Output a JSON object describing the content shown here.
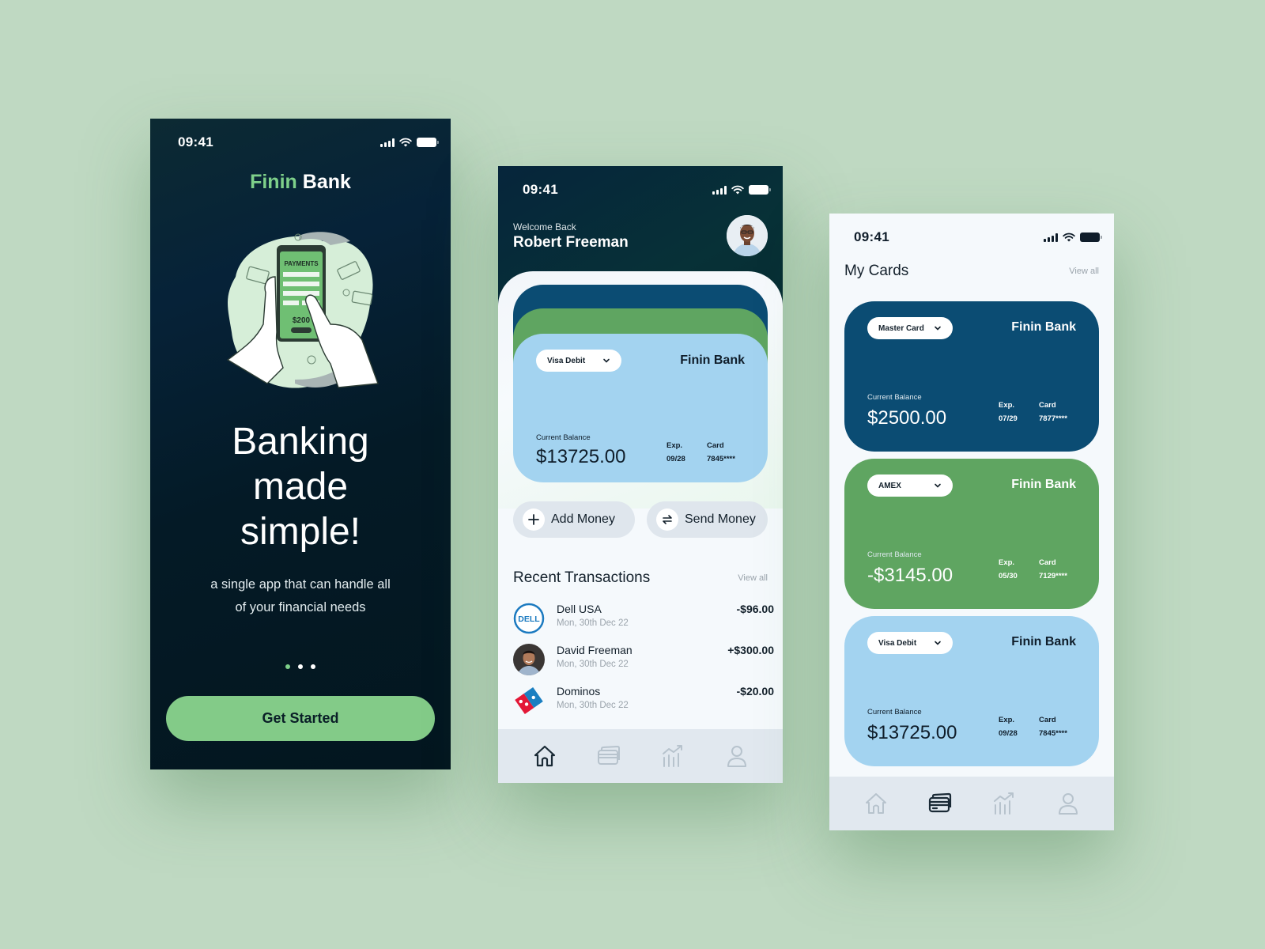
{
  "colors": {
    "background": "#bfd9c2",
    "brand_green": "#7ed08a",
    "button_green": "#83cb88",
    "navy_dark": "#03161f",
    "card_blue": "#0b4c73",
    "card_green": "#5fa561",
    "card_light_blue": "#a3d3f0"
  },
  "onboarding": {
    "status_time": "09:41",
    "brand_primary": "Finin",
    "brand_secondary": "Bank",
    "illustration": "payments-phone-illustration",
    "headline_lines": [
      "Banking",
      "made",
      "simple!"
    ],
    "subtitle_lines": [
      "a single app that can handle all",
      "of your financial needs"
    ],
    "page_indicator": {
      "count": 3,
      "active_index": 0
    },
    "cta_label": "Get Started"
  },
  "home": {
    "status_time": "09:41",
    "welcome_text": "Welcome Back",
    "user_name": "Robert Freeman",
    "active_card": {
      "type": "Visa Debit",
      "bank": "Finin Bank",
      "balance_label": "Current Balance",
      "balance": "$13725.00",
      "exp_label": "Exp.",
      "exp": "09/28",
      "card_label": "Card",
      "card_number": "7845****"
    },
    "actions": [
      {
        "label": "Add Money",
        "icon": "plus-icon"
      },
      {
        "label": "Send Money",
        "icon": "transfer-icon"
      }
    ],
    "transactions_title": "Recent Transactions",
    "view_all": "View all",
    "transactions": [
      {
        "name": "Dell USA",
        "date": "Mon, 30th Dec 22",
        "amount": "-$96.00",
        "logo": "dell-logo"
      },
      {
        "name": "David Freeman",
        "date": "Mon, 30th Dec 22",
        "amount": "+$300.00",
        "logo": "person-avatar"
      },
      {
        "name": "Dominos",
        "date": "Mon, 30th Dec 22",
        "amount": "-$20.00",
        "logo": "dominos-logo"
      }
    ],
    "nav": [
      {
        "name": "home",
        "icon": "home-icon",
        "active": true
      },
      {
        "name": "cards",
        "icon": "cards-icon",
        "active": false
      },
      {
        "name": "stats",
        "icon": "chart-icon",
        "active": false
      },
      {
        "name": "profile",
        "icon": "user-icon",
        "active": false
      }
    ]
  },
  "cards_screen": {
    "status_time": "09:41",
    "title": "My Cards",
    "view_all": "View all",
    "cards": [
      {
        "type": "Master Card",
        "bank": "Finin Bank",
        "balance_label": "Current Balance",
        "balance": "$2500.00",
        "exp_label": "Exp.",
        "exp": "07/29",
        "card_label": "Card",
        "card_number": "7877****",
        "color": "#0b4c73"
      },
      {
        "type": "AMEX",
        "bank": "Finin Bank",
        "balance_label": "Current Balance",
        "balance": "-$3145.00",
        "exp_label": "Exp.",
        "exp": "05/30",
        "card_label": "Card",
        "card_number": "7129****",
        "color": "#5fa561"
      },
      {
        "type": "Visa Debit",
        "bank": "Finin Bank",
        "balance_label": "Current Balance",
        "balance": "$13725.00",
        "exp_label": "Exp.",
        "exp": "09/28",
        "card_label": "Card",
        "card_number": "7845****",
        "color": "#a3d3f0"
      }
    ],
    "nav": [
      {
        "name": "home",
        "icon": "home-icon",
        "active": false
      },
      {
        "name": "cards",
        "icon": "cards-icon",
        "active": true
      },
      {
        "name": "stats",
        "icon": "chart-icon",
        "active": false
      },
      {
        "name": "profile",
        "icon": "user-icon",
        "active": false
      }
    ]
  }
}
